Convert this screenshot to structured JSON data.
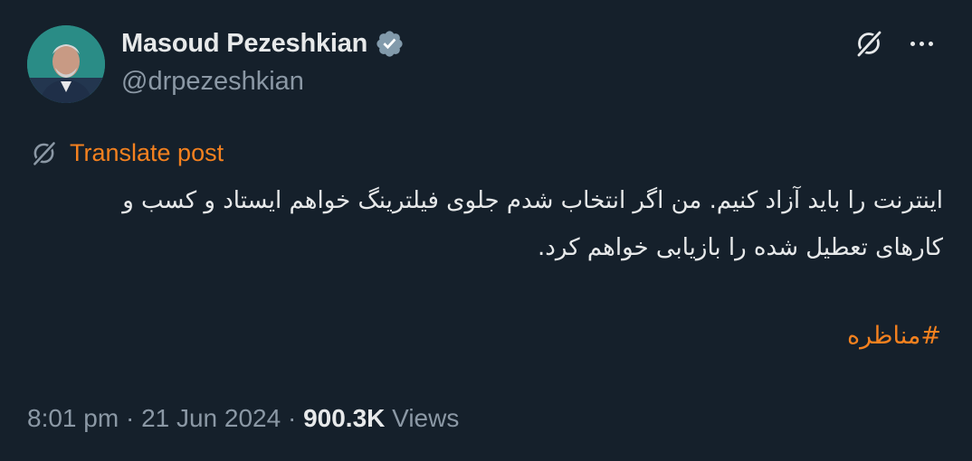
{
  "author": {
    "display_name": "Masoud Pezeshkian",
    "handle": "@drpezeshkian",
    "verified": true,
    "verified_color": "#829aab"
  },
  "actions": {
    "grok_icon": "grok-icon",
    "more_icon": "more-icon"
  },
  "translate": {
    "label": "Translate post",
    "color": "#f4811f"
  },
  "post": {
    "text": "اینترنت را باید آزاد کنیم. من اگر انتخاب شدم جلوی فیلترینگ خواهم ایستاد و کسب و کارهای تعطیل شده را بازیابی خواهم کرد.",
    "hashtag": "#مناظره"
  },
  "meta": {
    "time": "8:01 pm",
    "separator": " · ",
    "date": "21 Jun 2024",
    "views_count": "900.3K",
    "views_label": " Views"
  },
  "colors": {
    "background": "#15202b",
    "text_primary": "#e7e9ea",
    "text_secondary": "#8b98a5",
    "accent": "#f4811f"
  }
}
